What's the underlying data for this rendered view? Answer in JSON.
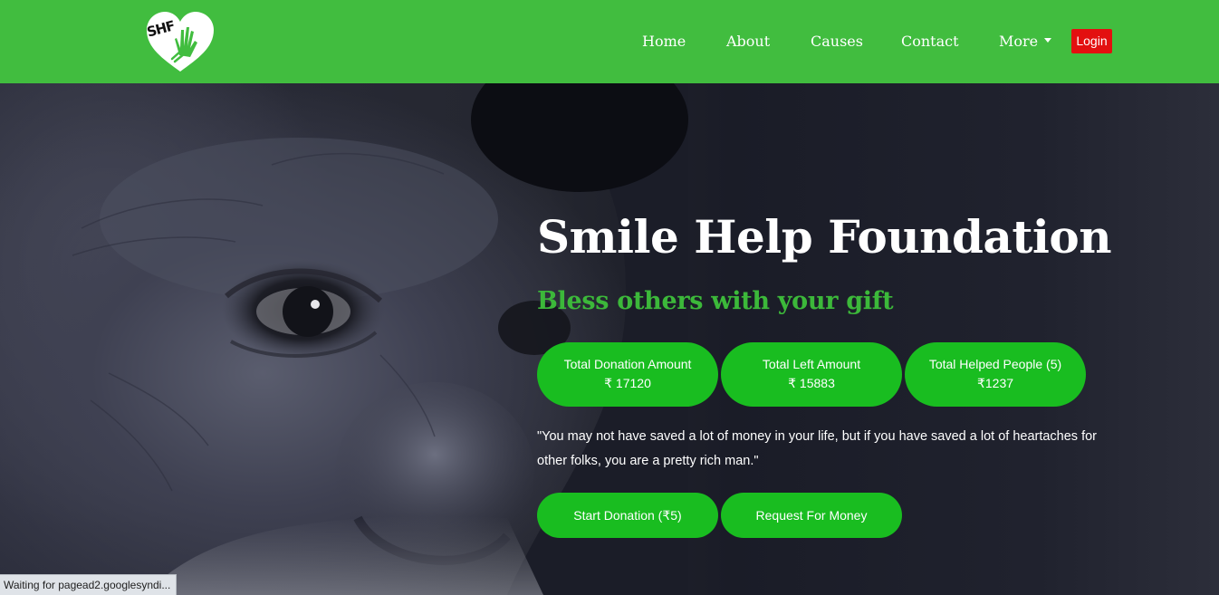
{
  "brand": {
    "logo_text": "SHF",
    "colors": {
      "nav_green": "#41bd3f",
      "button_green": "#19bd20",
      "subtitle_green": "#3cb83a",
      "login_red": "#e31010"
    }
  },
  "nav": {
    "items": [
      {
        "label": "Home"
      },
      {
        "label": "About"
      },
      {
        "label": "Causes"
      },
      {
        "label": "Contact"
      },
      {
        "label": "More"
      }
    ],
    "login_label": "Login"
  },
  "hero": {
    "title": "Smile Help Foundation",
    "subtitle": "Bless others with your gift",
    "stats": [
      {
        "label": "Total Donation Amount",
        "value": "₹ 17120"
      },
      {
        "label": "Total Left Amount",
        "value": "₹ 15883"
      },
      {
        "label": "Total Helped People (5)",
        "value": "₹1237"
      }
    ],
    "quote": "\"You may not have saved a lot of money in your life, but if you have saved a lot of heartaches for other folks, you are a pretty rich man.\"",
    "buttons": {
      "start_donation": "Start Donation (₹5)",
      "request_money": "Request For Money"
    }
  },
  "browser_status": "Waiting for pagead2.googlesyndi..."
}
